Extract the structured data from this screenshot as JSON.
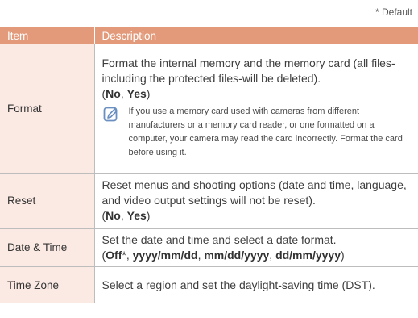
{
  "default_note": "* Default",
  "header": {
    "item": "Item",
    "description": "Description"
  },
  "rows": [
    {
      "item": "Format",
      "desc_text": "Format the internal memory and the memory card (all files-including the protected files-will be deleted).",
      "options_open": "(",
      "opt1": "No",
      "sep1": ", ",
      "opt2": "Yes",
      "options_close": ")",
      "note_icon": "note-pencil-icon",
      "note": "If you use a memory card used with cameras from different manufacturers or a memory card reader, or one formatted on a computer, your camera may read the card incorrectly. Format the card before using it."
    },
    {
      "item": "Reset",
      "desc_text": "Reset menus and shooting options (date and time, language, and video output settings will not be reset).",
      "options_open": "(",
      "opt1": "No",
      "sep1": ", ",
      "opt2": "Yes",
      "options_close": ")"
    },
    {
      "item": "Date & Time",
      "desc_text": "Set the date and time and select a date format.",
      "options_open": "(",
      "opt1": "Off",
      "opt1_mark": "*",
      "sep1": ", ",
      "opt2": "yyyy/mm/dd",
      "sep2": ", ",
      "opt3": "mm/dd/yyyy",
      "sep3": ", ",
      "opt4": "dd/mm/yyyy",
      "options_close": ")"
    },
    {
      "item": "Time Zone",
      "desc_text": "Select a region and set the daylight-saving time (DST)."
    }
  ],
  "colors": {
    "header_bg": "#e39a7a",
    "item_bg": "#fbeae3",
    "border": "#bdbdbd",
    "icon": "#6a8fc0"
  }
}
